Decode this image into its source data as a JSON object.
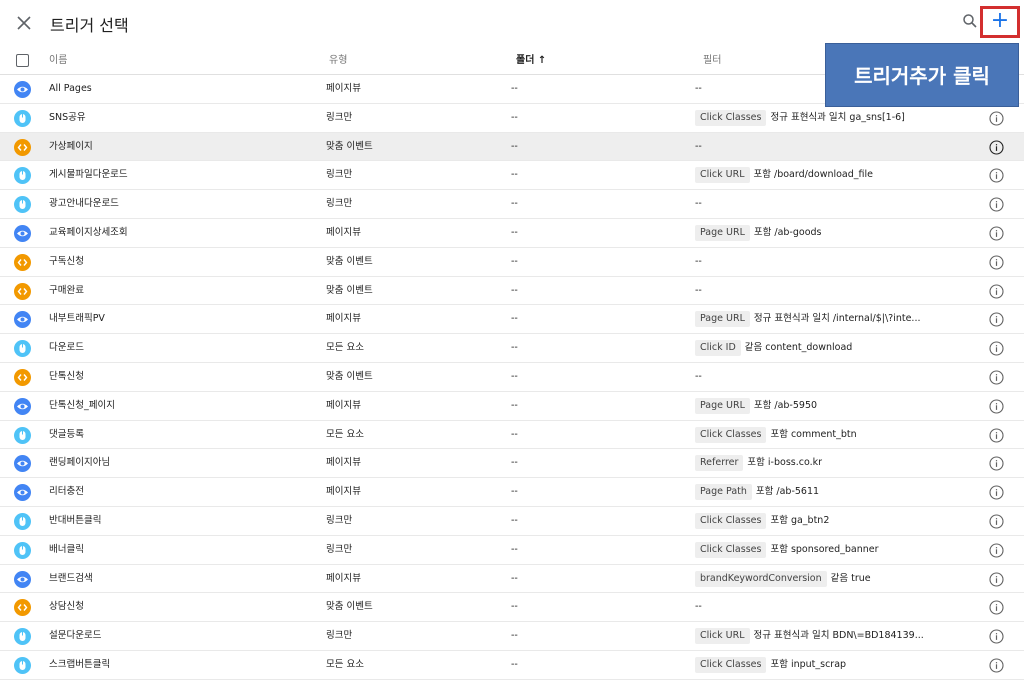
{
  "header": {
    "title": "트리거 선택",
    "close_icon": "close-icon",
    "search_icon": "search-icon",
    "add_label": "+"
  },
  "callout": {
    "text": "트리거추가 클릭"
  },
  "columns": {
    "name": "이름",
    "type": "유형",
    "folder": "폴더 ↑",
    "filter": "필터"
  },
  "colors": {
    "pageview": "#4285f4",
    "click": "#4fc3f7",
    "custom": "#f29900",
    "highlight": "#eeeeee",
    "accent": "#1a73e8",
    "callout": "#4a76b8",
    "annotation_border": "#d32f2f"
  },
  "rows": [
    {
      "icon": "pageview",
      "name": "All Pages",
      "type": "페이지뷰",
      "folder": "--",
      "chip": "",
      "filter": "--"
    },
    {
      "icon": "click",
      "name": "SNS공유",
      "type": "링크만",
      "folder": "--",
      "chip": "Click Classes",
      "filter": "정규 표현식과 일치 ga_sns[1-6]"
    },
    {
      "icon": "custom",
      "name": "가상페이지",
      "type": "맞춤 이벤트",
      "folder": "--",
      "chip": "",
      "filter": "--",
      "highlight": true
    },
    {
      "icon": "click",
      "name": "게시물파일다운로드",
      "type": "링크만",
      "folder": "--",
      "chip": "Click URL",
      "filter": "포함 /board/download_file"
    },
    {
      "icon": "click",
      "name": "광고안내다운로드",
      "type": "링크만",
      "folder": "--",
      "chip": "",
      "filter": "--"
    },
    {
      "icon": "pageview",
      "name": "교육페이지상세조회",
      "type": "페이지뷰",
      "folder": "--",
      "chip": "Page URL",
      "filter": "포함 /ab-goods"
    },
    {
      "icon": "custom",
      "name": "구독신청",
      "type": "맞춤 이벤트",
      "folder": "--",
      "chip": "",
      "filter": "--"
    },
    {
      "icon": "custom",
      "name": "구매완료",
      "type": "맞춤 이벤트",
      "folder": "--",
      "chip": "",
      "filter": "--"
    },
    {
      "icon": "pageview",
      "name": "내부트래픽PV",
      "type": "페이지뷰",
      "folder": "--",
      "chip": "Page URL",
      "filter": "정규 표현식과 일치 /internal/$|\\?inte..."
    },
    {
      "icon": "click",
      "name": "다운로드",
      "type": "모든 요소",
      "folder": "--",
      "chip": "Click ID",
      "filter": "같음 content_download"
    },
    {
      "icon": "custom",
      "name": "단톡신청",
      "type": "맞춤 이벤트",
      "folder": "--",
      "chip": "",
      "filter": "--"
    },
    {
      "icon": "pageview",
      "name": "단톡신청_페이지",
      "type": "페이지뷰",
      "folder": "--",
      "chip": "Page URL",
      "filter": "포함 /ab-5950"
    },
    {
      "icon": "click",
      "name": "댓글등록",
      "type": "모든 요소",
      "folder": "--",
      "chip": "Click Classes",
      "filter": "포함 comment_btn"
    },
    {
      "icon": "pageview",
      "name": "랜딩페이지아님",
      "type": "페이지뷰",
      "folder": "--",
      "chip": "Referrer",
      "filter": "포함 i-boss.co.kr"
    },
    {
      "icon": "pageview",
      "name": "리터충전",
      "type": "페이지뷰",
      "folder": "--",
      "chip": "Page Path",
      "filter": "포함 /ab-5611"
    },
    {
      "icon": "click",
      "name": "반대버튼클릭",
      "type": "링크만",
      "folder": "--",
      "chip": "Click Classes",
      "filter": "포함 ga_btn2"
    },
    {
      "icon": "click",
      "name": "배너클릭",
      "type": "링크만",
      "folder": "--",
      "chip": "Click Classes",
      "filter": "포함 sponsored_banner"
    },
    {
      "icon": "pageview",
      "name": "브랜드검색",
      "type": "페이지뷰",
      "folder": "--",
      "chip": "brandKeywordConversion",
      "filter": "같음 true"
    },
    {
      "icon": "custom",
      "name": "상담신청",
      "type": "맞춤 이벤트",
      "folder": "--",
      "chip": "",
      "filter": "--"
    },
    {
      "icon": "click",
      "name": "설문다운로드",
      "type": "링크만",
      "folder": "--",
      "chip": "Click URL",
      "filter": "정규 표현식과 일치 BDN\\=BD184139..."
    },
    {
      "icon": "click",
      "name": "스크랩버튼클릭",
      "type": "모든 요소",
      "folder": "--",
      "chip": "Click Classes",
      "filter": "포함 input_scrap"
    }
  ]
}
